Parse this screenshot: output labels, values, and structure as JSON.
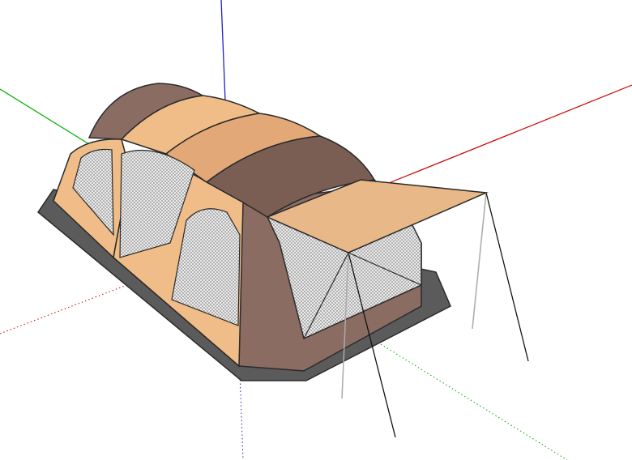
{
  "scene": {
    "title": "",
    "colors": {
      "background": "#ffffff",
      "tent_tan": "#f0bd88",
      "tent_tan_shade": "#e3a877",
      "tent_brown": "#8a6c62",
      "tent_brown_dark": "#6f534a",
      "floor": "#5b5b5b",
      "outline": "#2a2a2a",
      "axis_red": "#cc0000",
      "axis_green": "#00aa00",
      "axis_blue": "#0000cc",
      "mesh": "#cfcfcf"
    },
    "axes": [
      "red-axis",
      "green-axis",
      "blue-axis"
    ],
    "objects": [
      "ground-floor",
      "tent-body",
      "mesh-windows",
      "awning",
      "awning-poles"
    ]
  }
}
